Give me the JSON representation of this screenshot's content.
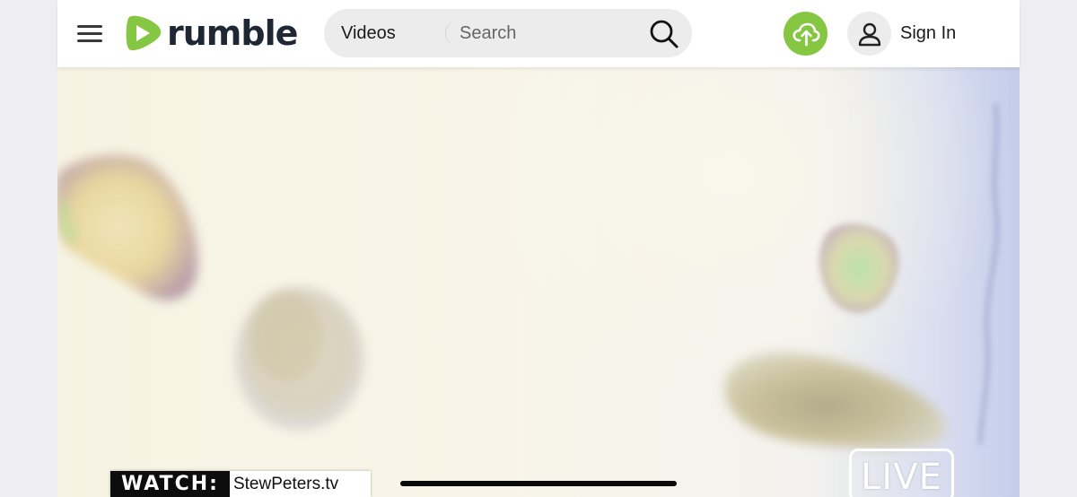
{
  "header": {
    "logo_text": "rumble",
    "search": {
      "category": "Videos",
      "placeholder": "Search"
    },
    "sign_in_label": "Sign In"
  },
  "video": {
    "watermark_label": "WATCH:",
    "watermark_site": "StewPeters.tv",
    "live_badge": "LIVE"
  },
  "icons": {
    "menu": "hamburger-menu-icon",
    "search": "search-icon",
    "upload": "cloud-upload-icon",
    "user": "user-icon"
  },
  "colors": {
    "brand_green": "#85c742",
    "logo_text": "#1e2733",
    "header_bg": "#ffffff",
    "search_bg": "#ececec"
  }
}
